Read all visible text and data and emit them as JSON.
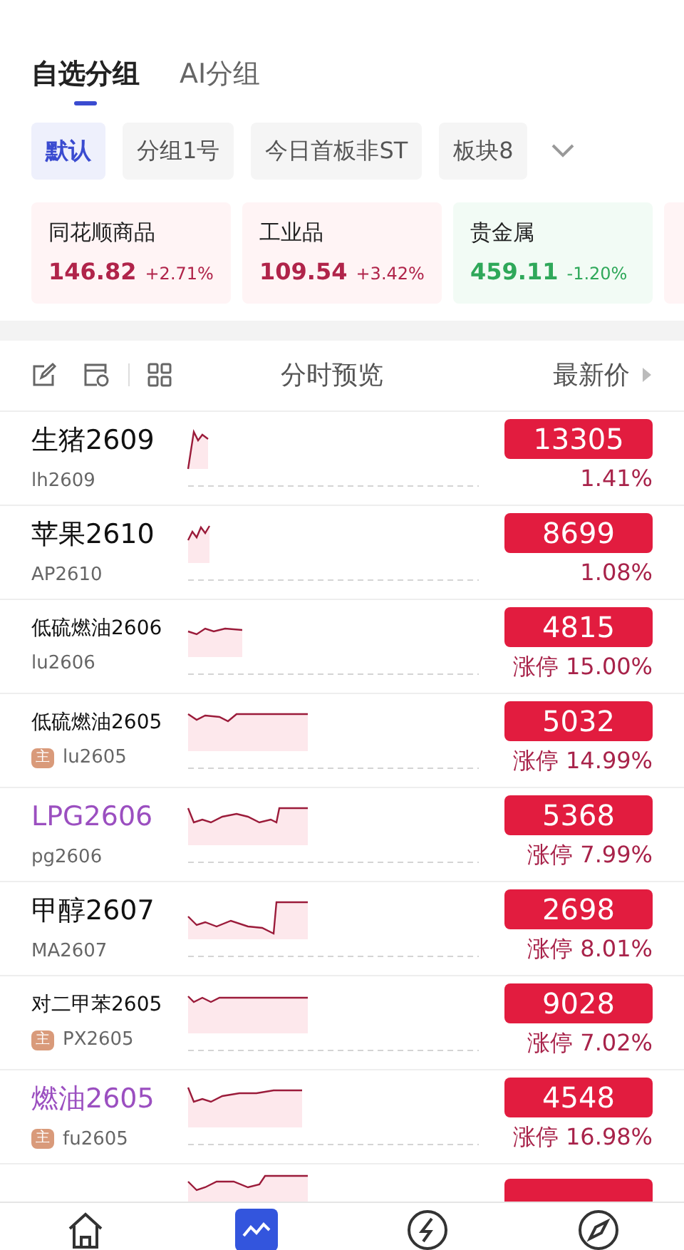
{
  "group_tabs": [
    {
      "label": "自选分组",
      "selected": true
    },
    {
      "label": "AI分组",
      "selected": false
    }
  ],
  "chips": [
    {
      "label": "默认",
      "selected": true
    },
    {
      "label": "分组1号",
      "selected": false
    },
    {
      "label": "今日首板非ST",
      "selected": false
    },
    {
      "label": "板块8",
      "selected": false
    }
  ],
  "index_cards": [
    {
      "name": "同花顺商品",
      "value": "146.82",
      "change": "+2.71%",
      "color": "#b0244a"
    },
    {
      "name": "工业品",
      "value": "109.54",
      "change": "+3.42%",
      "color": "#b0244a"
    },
    {
      "name": "贵金属",
      "value": "459.11",
      "change": "-1.20%",
      "color": "#2fa85a"
    }
  ],
  "columns": {
    "preview": "分时预览",
    "price": "最新价"
  },
  "rows": [
    {
      "name": "生猪2609",
      "code": "lh2609",
      "price": "13305",
      "change": "1.41%",
      "main": false,
      "highlight": false,
      "long": false
    },
    {
      "name": "苹果2610",
      "code": "AP2610",
      "price": "8699",
      "change": "1.08%",
      "main": false,
      "highlight": false,
      "long": false
    },
    {
      "name": "低硫燃油2606",
      "code": "lu2606",
      "price": "4815",
      "change": "涨停 15.00%",
      "main": false,
      "highlight": false,
      "long": true
    },
    {
      "name": "低硫燃油2605",
      "code": "lu2605",
      "price": "5032",
      "change": "涨停 14.99%",
      "main": true,
      "main_label": "主",
      "highlight": false,
      "long": true
    },
    {
      "name": "LPG2606",
      "code": "pg2606",
      "price": "5368",
      "change": "涨停 7.99%",
      "main": false,
      "highlight": true,
      "long": false
    },
    {
      "name": "甲醇2607",
      "code": "MA2607",
      "price": "2698",
      "change": "涨停 8.01%",
      "main": false,
      "highlight": false,
      "long": false
    },
    {
      "name": "对二甲苯2605",
      "code": "PX2605",
      "price": "9028",
      "change": "涨停 7.02%",
      "main": true,
      "main_label": "主",
      "highlight": false,
      "long": true
    },
    {
      "name": "燃油2605",
      "code": "fu2605",
      "price": "4548",
      "change": "涨停 16.98%",
      "main": true,
      "main_label": "主",
      "highlight": true,
      "long": false
    }
  ],
  "nav": [
    {
      "kind": "home",
      "selected": false
    },
    {
      "kind": "chart",
      "selected": true
    },
    {
      "kind": "trade",
      "selected": false
    },
    {
      "kind": "discover",
      "selected": false
    }
  ]
}
